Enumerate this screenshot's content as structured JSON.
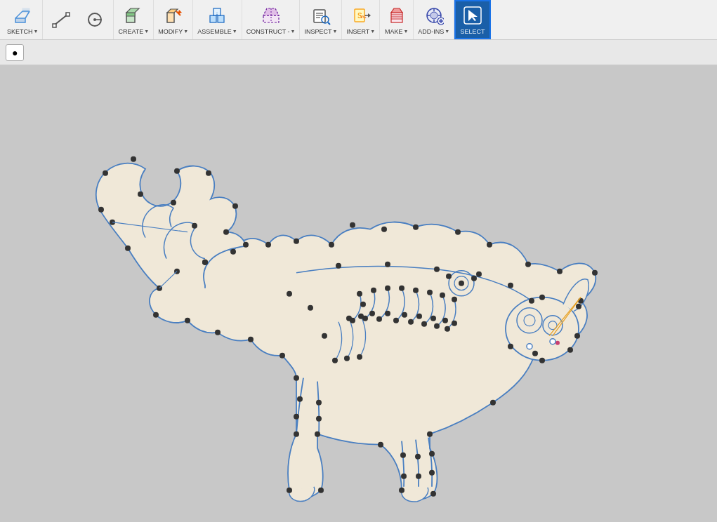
{
  "toolbar": {
    "groups": [
      {
        "id": "sketch",
        "label": "SKETCH",
        "hasArrow": true
      },
      {
        "id": "create",
        "label": "CREATE",
        "hasArrow": true
      },
      {
        "id": "modify",
        "label": "MODIFY",
        "hasArrow": true
      },
      {
        "id": "assemble",
        "label": "ASSEMBLE",
        "hasArrow": true
      },
      {
        "id": "construct",
        "label": "CONSTRUCT -",
        "hasArrow": true
      },
      {
        "id": "inspect",
        "label": "INSPECT",
        "hasArrow": true
      },
      {
        "id": "insert",
        "label": "INSERT",
        "hasArrow": true
      },
      {
        "id": "make",
        "label": "MAKE",
        "hasArrow": true
      },
      {
        "id": "add-ins",
        "label": "ADD-INS",
        "hasArrow": true
      },
      {
        "id": "select",
        "label": "SELECT",
        "hasArrow": false,
        "active": true
      }
    ]
  },
  "subtoolbar": {
    "button": "●"
  }
}
